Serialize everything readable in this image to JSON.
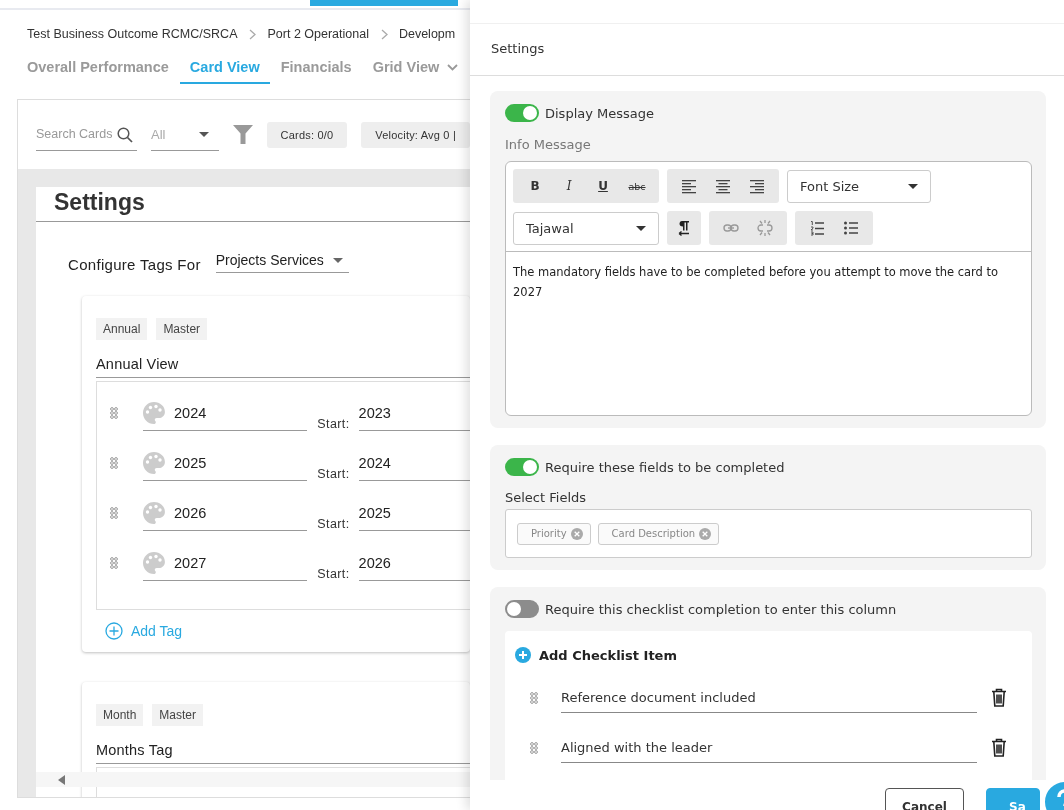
{
  "breadcrumb": [
    "Test Business Outcome RCMC/SRCA",
    "Port 2 Operational",
    "Developm"
  ],
  "tabs": [
    {
      "label": "Overall Performance",
      "selected": false,
      "dropdown": false
    },
    {
      "label": "Card View",
      "selected": true,
      "dropdown": false
    },
    {
      "label": "Financials",
      "selected": false,
      "dropdown": false
    },
    {
      "label": "Grid View",
      "selected": false,
      "dropdown": true
    }
  ],
  "toolbar": {
    "search": {
      "placeholder": "Search Cards"
    },
    "filter": {
      "value": "All"
    },
    "chips": [
      "Cards: 0/0",
      "Velocity: Avg 0 |"
    ]
  },
  "settings_page": {
    "title": "Settings",
    "configure_label": "Configure Tags For",
    "configure_value": "Projects Services",
    "tag_groups": [
      {
        "chips": [
          "Annual",
          "Master"
        ],
        "name": "Annual View",
        "add_label": "Add Tag",
        "tags": [
          {
            "name": "2024",
            "start_label": "Start:",
            "start": "2023"
          },
          {
            "name": "2025",
            "start_label": "Start:",
            "start": "2024"
          },
          {
            "name": "2026",
            "start_label": "Start:",
            "start": "2025"
          },
          {
            "name": "2027",
            "start_label": "Start:",
            "start": "2026"
          }
        ]
      },
      {
        "chips": [
          "Month",
          "Master"
        ],
        "name": "Months Tag"
      }
    ]
  },
  "panel": {
    "title": "Settings",
    "display_message": {
      "label": "Display Message",
      "on": true,
      "info_label": "Info Message",
      "format_buttons": [
        "B",
        "I",
        "U",
        "abc"
      ],
      "font_size": "Font Size",
      "font": "Tajawal",
      "text": "The mandatory fields have to be completed before you attempt to move the card to 2027"
    },
    "require_fields": {
      "label": "Require these fields to be completed",
      "on": true,
      "select_label": "Select Fields",
      "fields": [
        "Priority",
        "Card Description"
      ]
    },
    "checklist": {
      "label": "Require this checklist completion to enter this column",
      "on": false,
      "add_label": "Add Checklist Item",
      "items": [
        "Reference document included",
        "Aligned with the leader"
      ]
    },
    "buttons": {
      "cancel": "Cancel",
      "save": "Sa"
    }
  }
}
